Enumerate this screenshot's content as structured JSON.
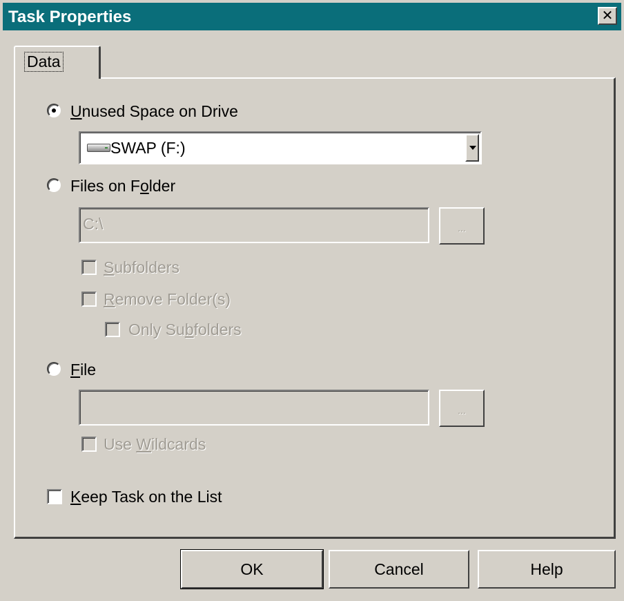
{
  "window": {
    "title": "Task Properties",
    "close_glyph": "✕",
    "accent_color": "#0a6e7a"
  },
  "tabs": [
    {
      "label": "Data",
      "selected": true
    }
  ],
  "options": {
    "unused_space": {
      "label_pre": "",
      "label_ul": "U",
      "label_post": "nused Space on Drive",
      "selected": true,
      "drive_value": "SWAP (F:)",
      "drive_icon": "hard-drive-icon"
    },
    "files_on_folder": {
      "label_pre": "Files on F",
      "label_ul": "o",
      "label_post": "lder",
      "selected": false,
      "path_value": "C:\\",
      "browse_label": "...",
      "subfolders": {
        "pre": "",
        "ul": "S",
        "post": "ubfolders",
        "checked": false
      },
      "remove_folders": {
        "pre": "",
        "ul": "R",
        "post": "emove Folder(s)",
        "checked": false
      },
      "only_subfolders": {
        "pre": "Only Su",
        "ul": "b",
        "post": "folders",
        "checked": false
      }
    },
    "file": {
      "label_pre": "",
      "label_ul": "F",
      "label_post": "ile",
      "selected": false,
      "path_value": "",
      "browse_label": "...",
      "use_wildcards": {
        "pre": "Use ",
        "ul": "W",
        "post": "ildcards",
        "checked": false
      }
    },
    "keep_task": {
      "label_pre": "",
      "label_ul": "K",
      "label_post": "eep Task on the List",
      "checked": false
    }
  },
  "buttons": {
    "ok": "OK",
    "cancel": "Cancel",
    "help": "Help"
  }
}
